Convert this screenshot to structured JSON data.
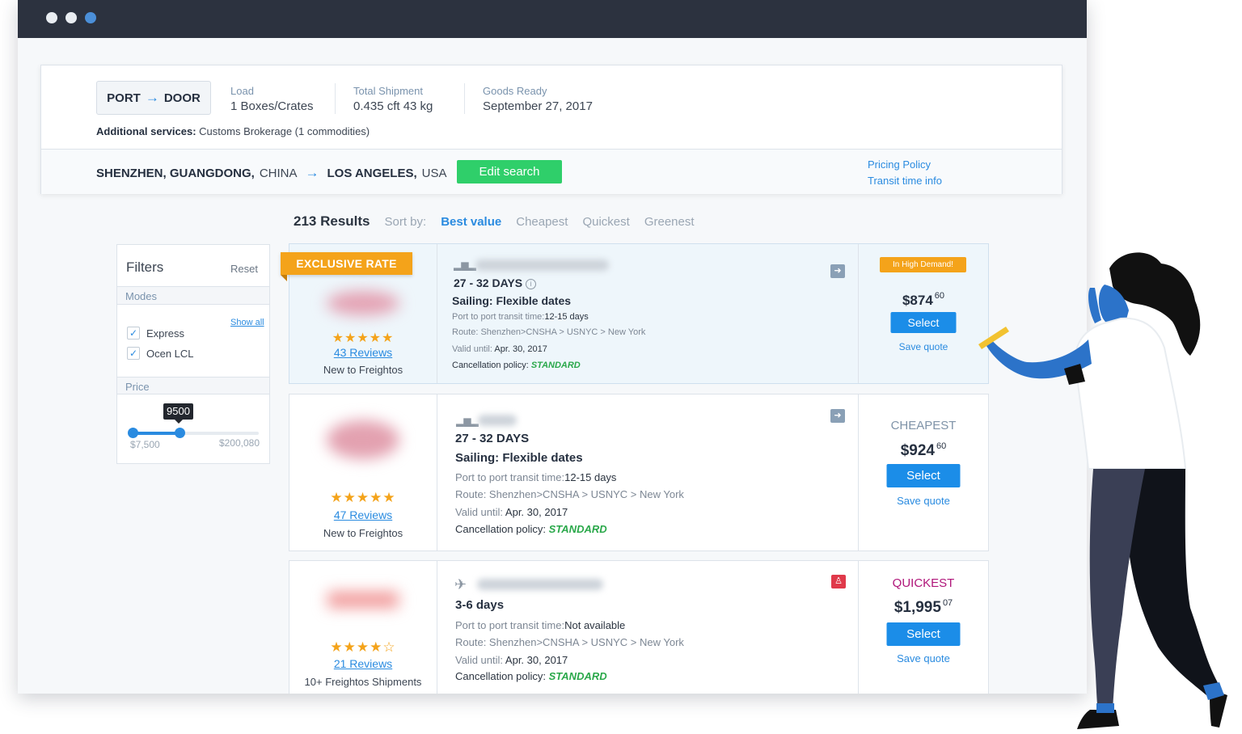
{
  "search": {
    "mode": {
      "from": "PORT",
      "to": "DOOR"
    },
    "load": {
      "label": "Load",
      "value": "1 Boxes/Crates"
    },
    "total": {
      "label": "Total Shipment",
      "value": "0.435 cft 43 kg"
    },
    "ready": {
      "label": "Goods Ready",
      "value": "September 27, 2017"
    },
    "additional_label": "Additional services:",
    "additional_value": "Customs Brokerage (1 commodities)",
    "origin_city": "SHENZHEN, GUANGDONG,",
    "origin_country": "CHINA",
    "dest_city": "LOS ANGELES,",
    "dest_country": "USA",
    "edit_label": "Edit search",
    "pricing_policy": "Pricing Policy",
    "transit_info": "Transit time info"
  },
  "results": {
    "count": "213 Results",
    "sort_label": "Sort by:",
    "sort_options": [
      "Best value",
      "Cheapest",
      "Quickest",
      "Greenest"
    ]
  },
  "filters": {
    "title": "Filters",
    "reset": "Reset",
    "modes_label": "Modes",
    "show_all": "Show all",
    "mode_options": [
      "Express",
      "Ocen LCL"
    ],
    "price_label": "Price",
    "price_tooltip": "9500",
    "price_min": "$7,500",
    "price_max": "$200,080",
    "slider_value_fraction": 0.37
  },
  "exclusive_badge": "EXCLUSIVE RATE",
  "quotes": [
    {
      "stars": "★★★★★",
      "rating": 5,
      "reviews": "43 Reviews",
      "note": "New to Freightos",
      "days": "27 - 32 DAYS",
      "sailing": "Sailing: Flexible dates",
      "transit_label": "Port to port transit time:",
      "transit_value": "12-15 days",
      "route": "Route: Shenzhen>CNSHA > USNYC > New York",
      "valid_label": "Valid until:",
      "valid_value": "Apr. 30, 2017",
      "cancel_label": "Cancellation policy:",
      "cancel_value": "STANDARD",
      "tag": "In High Demand!",
      "price_main": "$874",
      "price_cents": "60",
      "select": "Select",
      "save": "Save quote"
    },
    {
      "stars": "★★★★★",
      "rating": 5,
      "reviews": "47 Reviews",
      "note": "New to Freightos",
      "days": "27 - 32 DAYS",
      "sailing": "Sailing: Flexible dates",
      "transit_label": "Port to port transit time:",
      "transit_value": "12-15 days",
      "route": "Route: Shenzhen>CNSHA > USNYC > New York",
      "valid_label": "Valid until:",
      "valid_value": "Apr. 30, 2017",
      "cancel_label": "Cancellation policy:",
      "cancel_value": "STANDARD",
      "tag": "CHEAPEST",
      "price_main": "$924",
      "price_cents": "60",
      "select": "Select",
      "save": "Save quote"
    },
    {
      "stars": "★★★★☆",
      "rating": 4,
      "reviews": "21 Reviews",
      "note": "10+ Freightos Shipments",
      "days": "3-6 days",
      "transit_label": "Port to port transit time:",
      "transit_value": "Not available",
      "route": "Route: Shenzhen>CNSHA > USNYC > New York",
      "valid_label": "Valid until:",
      "valid_value": "Apr. 30, 2017",
      "cancel_label": "Cancellation policy:",
      "cancel_value": "STANDARD",
      "tag": "QUICKEST",
      "price_main": "$1,995",
      "price_cents": "07",
      "select": "Select",
      "save": "Save quote"
    }
  ],
  "colors": {
    "accent": "#2a8be0",
    "success": "#2fcf6a",
    "badge_orange": "#f4a31a",
    "cheapest": "#7f93a8",
    "quickest": "#b0167a",
    "titlebar": "#2c323f"
  },
  "icons": [
    "ship-icon",
    "plane-icon",
    "arrow-right-icon",
    "info-icon",
    "check-icon",
    "express-badge-icon"
  ]
}
